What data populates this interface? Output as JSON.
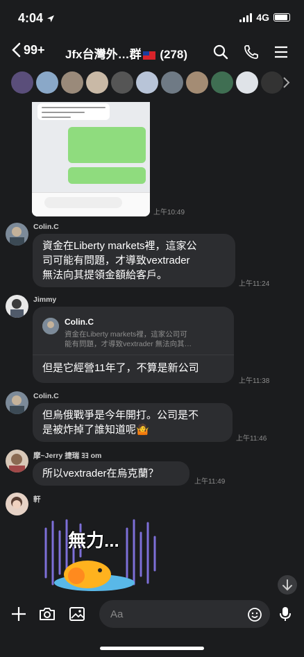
{
  "status_bar": {
    "time": "4:04",
    "network": "4G"
  },
  "header": {
    "back_count": "99+",
    "title_prefix": "Jfx台灣外…群",
    "member_count": "(278)"
  },
  "colors": {
    "background": "#1b1c1e",
    "bubble": "#2c2d30",
    "accent_green": "#8fdc7e"
  },
  "messages": [
    {
      "type": "image",
      "time": "上午10:49"
    },
    {
      "sender": "Colin.C",
      "text": [
        "資金在Liberty markets裡，這家公",
        "司可能有問題，才導致vextrader",
        "無法向其提領金額給客戶。"
      ],
      "time": "上午11:24"
    },
    {
      "sender": "Jimmy",
      "reply_to": {
        "name": "Colin.C",
        "text": [
          "資金在Liberty markets裡，這家公司可",
          "能有問題，才導致vextrader 無法向其…"
        ]
      },
      "text": [
        "但是它經營11年了，不算是新公司"
      ],
      "time": "上午11:38"
    },
    {
      "sender": "Colin.C",
      "text": [
        "但烏俄戰爭是今年開打。公司是不",
        "是被炸掉了誰知道呢🤷"
      ],
      "time": "上午11:46"
    },
    {
      "sender": "摩~Jerry 捷瑞 ﾖﾖ om",
      "text": [
        "所以vextrader在烏克蘭？"
      ],
      "time": "上午11:49"
    },
    {
      "sender": "軒",
      "sticker_text": "無力..."
    }
  ],
  "input": {
    "placeholder": "Aa"
  }
}
